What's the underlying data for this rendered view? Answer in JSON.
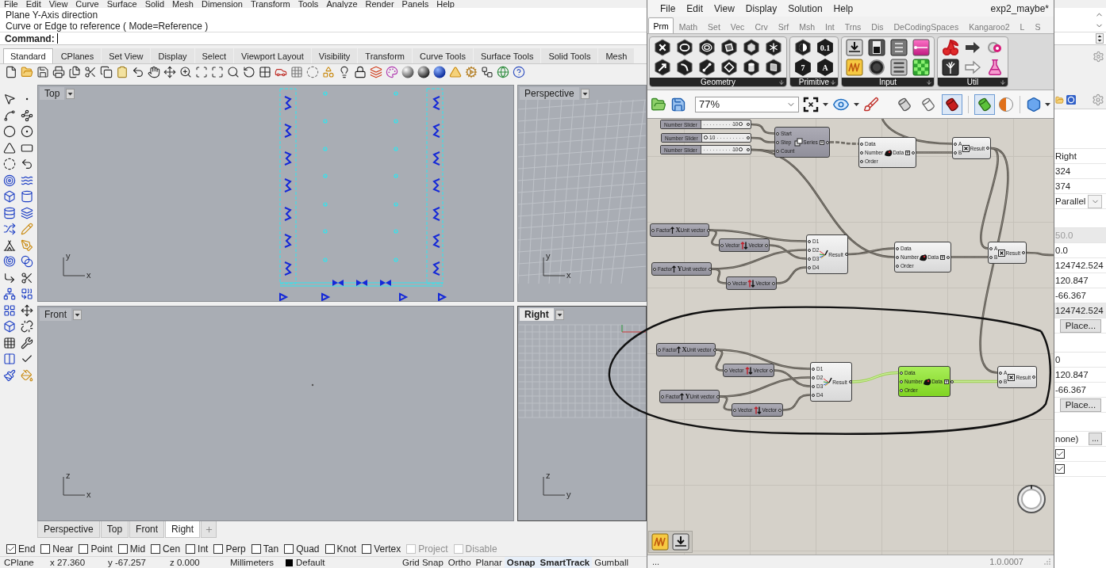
{
  "rhino": {
    "menu": [
      "File",
      "Edit",
      "View",
      "Curve",
      "Surface",
      "Solid",
      "Mesh",
      "Dimension",
      "Transform",
      "Tools",
      "Analyze",
      "Render",
      "Panels",
      "Help"
    ],
    "command_history": [
      "Plane Y-Axis direction",
      "Curve or Edge to reference ( Mode=Reference )"
    ],
    "command_prompt": "Command:",
    "toolbar_tabs": [
      {
        "label": "Standard",
        "selected": true
      },
      {
        "label": "CPlanes",
        "selected": false
      },
      {
        "label": "Set View",
        "selected": false
      },
      {
        "label": "Display",
        "selected": false
      },
      {
        "label": "Select",
        "selected": false
      },
      {
        "label": "Viewport Layout",
        "selected": false
      },
      {
        "label": "Visibility",
        "selected": false
      },
      {
        "label": "Transform",
        "selected": false
      },
      {
        "label": "Curve Tools",
        "selected": false
      },
      {
        "label": "Surface Tools",
        "selected": false
      },
      {
        "label": "Solid Tools",
        "selected": false
      },
      {
        "label": "Mesh",
        "selected": false
      }
    ],
    "viewports": [
      {
        "kind": "top",
        "title": "Top",
        "active": false,
        "axes": [
          "y",
          "x"
        ]
      },
      {
        "kind": "perspective",
        "title": "Perspective",
        "active": false,
        "axes": [
          "y",
          "x"
        ]
      },
      {
        "kind": "front",
        "title": "Front",
        "active": false,
        "axes": [
          "z",
          "x"
        ]
      },
      {
        "kind": "right",
        "title": "Right",
        "active": true,
        "axes": [
          "z",
          "y"
        ]
      }
    ],
    "viewport_tabs": [
      {
        "label": "Perspective",
        "selected": false
      },
      {
        "label": "Top",
        "selected": false
      },
      {
        "label": "Front",
        "selected": false
      },
      {
        "label": "Right",
        "selected": true
      }
    ],
    "osnaps": [
      {
        "label": "End",
        "checked": true,
        "disabled": false
      },
      {
        "label": "Near",
        "checked": false,
        "disabled": false
      },
      {
        "label": "Point",
        "checked": false,
        "disabled": false
      },
      {
        "label": "Mid",
        "checked": false,
        "disabled": false
      },
      {
        "label": "Cen",
        "checked": false,
        "disabled": false
      },
      {
        "label": "Int",
        "checked": false,
        "disabled": false
      },
      {
        "label": "Perp",
        "checked": false,
        "disabled": false
      },
      {
        "label": "Tan",
        "checked": false,
        "disabled": false
      },
      {
        "label": "Quad",
        "checked": false,
        "disabled": false
      },
      {
        "label": "Knot",
        "checked": false,
        "disabled": false
      },
      {
        "label": "Vertex",
        "checked": false,
        "disabled": false
      },
      {
        "label": "Project",
        "checked": false,
        "disabled": true
      },
      {
        "label": "Disable",
        "checked": false,
        "disabled": true
      }
    ],
    "status_bar": {
      "cplane": "CPlane",
      "x": "x 27.360",
      "y": "y -67.257",
      "z": "z 0.000",
      "units": "Millimeters",
      "layer": "Default",
      "toggles": [
        {
          "label": "Grid Snap",
          "on": false
        },
        {
          "label": "Ortho",
          "on": false
        },
        {
          "label": "Planar",
          "on": false
        },
        {
          "label": "Osnap",
          "on": true
        },
        {
          "label": "SmartTrack",
          "on": true
        },
        {
          "label": "Gumball",
          "on": false
        }
      ]
    },
    "properties": [
      [
        {
          "kind": "text",
          "value": "Right"
        },
        {
          "kind": "text",
          "value": "324"
        },
        {
          "kind": "text",
          "value": "374"
        },
        {
          "kind": "select",
          "value": "Parallel"
        }
      ],
      [
        {
          "kind": "disabled",
          "value": "50.0"
        },
        {
          "kind": "text",
          "value": "0.0"
        },
        {
          "kind": "text",
          "value": "124742.524"
        },
        {
          "kind": "text",
          "value": "120.847"
        },
        {
          "kind": "text",
          "value": "-66.367"
        },
        {
          "kind": "readonly",
          "value": "124742.524"
        },
        {
          "kind": "button",
          "value": "Place..."
        }
      ],
      [
        {
          "kind": "text",
          "value": "0"
        },
        {
          "kind": "text",
          "value": "120.847"
        },
        {
          "kind": "text",
          "value": "-66.367"
        },
        {
          "kind": "button",
          "value": "Place..."
        }
      ],
      [
        {
          "kind": "browse",
          "value": "none)",
          "button": "..."
        },
        {
          "kind": "checkbox",
          "checked": true
        },
        {
          "kind": "checkbox",
          "checked": true
        }
      ]
    ]
  },
  "grasshopper": {
    "menu": [
      "File",
      "Edit",
      "View",
      "Display",
      "Solution",
      "Help"
    ],
    "document": "exp2_maybe*",
    "tabs": [
      {
        "label": "Prm",
        "selected": true
      },
      {
        "label": "Math",
        "selected": false
      },
      {
        "label": "Set",
        "selected": false
      },
      {
        "label": "Vec",
        "selected": false
      },
      {
        "label": "Crv",
        "selected": false
      },
      {
        "label": "Srf",
        "selected": false
      },
      {
        "label": "Msh",
        "selected": false
      },
      {
        "label": "Int",
        "selected": false
      },
      {
        "label": "Trns",
        "selected": false
      },
      {
        "label": "Dis",
        "selected": false
      },
      {
        "label": "DeCodingSpaces",
        "selected": false
      },
      {
        "label": "Kangaroo2",
        "selected": false
      },
      {
        "label": "L",
        "selected": false
      },
      {
        "label": "S",
        "selected": false
      }
    ],
    "panels": [
      {
        "kind": "geometry",
        "title": "Geometry"
      },
      {
        "kind": "primitive",
        "title": "Primitive",
        "glyphs": [
          "0.1",
          "7",
          "A"
        ]
      },
      {
        "kind": "input",
        "title": "Input"
      },
      {
        "kind": "util",
        "title": "Util"
      }
    ],
    "zoom": "77%",
    "preview_modes": [
      {
        "selected": false
      },
      {
        "selected": false
      },
      {
        "selected": true
      }
    ],
    "selected_only_preview": true,
    "nodes": [
      {
        "kind": "slider",
        "label": "Number Slider",
        "value": "10",
        "level": 0.95
      },
      {
        "kind": "slider",
        "label": "Number Slider",
        "value": "10",
        "level": 0.05
      },
      {
        "kind": "slider",
        "label": "Number Slider",
        "value": "10",
        "level": 0.95
      },
      {
        "kind": "series",
        "inputs": [
          "Start",
          "Step",
          "Count"
        ],
        "outputs": [
          "Series"
        ],
        "dimmed": true,
        "selected": false
      },
      {
        "kind": "sort",
        "inputs": [
          "Data",
          "Number",
          "Order"
        ],
        "outputs": [
          "Data"
        ],
        "dimmed": false,
        "selected": false
      },
      {
        "kind": "multiply",
        "inputs": [
          "A",
          "B"
        ],
        "outputs": [
          "Result"
        ],
        "dimmed": false,
        "selected": false
      },
      {
        "kind": "unit-vector",
        "inputs": [
          "Factor"
        ],
        "outputs": [
          "Unit vector"
        ],
        "glyph": "X",
        "dimmed": true,
        "selected": false
      },
      {
        "kind": "reverse",
        "inputs": [
          "Vector"
        ],
        "outputs": [
          "Vector"
        ],
        "dimmed": true,
        "selected": false
      },
      {
        "kind": "unit-vector",
        "inputs": [
          "Factor"
        ],
        "outputs": [
          "Unit vector"
        ],
        "glyph": "Y",
        "dimmed": true,
        "selected": false
      },
      {
        "kind": "reverse",
        "inputs": [
          "Vector"
        ],
        "outputs": [
          "Vector"
        ],
        "dimmed": true,
        "selected": false
      },
      {
        "kind": "merge",
        "inputs": [
          "D1",
          "D2",
          "D3",
          "D4"
        ],
        "outputs": [
          "Result"
        ],
        "dimmed": false,
        "selected": false
      },
      {
        "kind": "sort",
        "inputs": [
          "Data",
          "Number",
          "Order"
        ],
        "outputs": [
          "Data"
        ],
        "dimmed": false,
        "selected": false
      },
      {
        "kind": "multiply",
        "inputs": [
          "A",
          "B"
        ],
        "outputs": [
          "Result"
        ],
        "dimmed": false,
        "selected": false
      },
      {
        "kind": "unit-vector",
        "inputs": [
          "Factor"
        ],
        "outputs": [
          "Unit vector"
        ],
        "glyph": "X",
        "dimmed": true,
        "selected": false
      },
      {
        "kind": "reverse",
        "inputs": [
          "Vector"
        ],
        "outputs": [
          "Vector"
        ],
        "dimmed": true,
        "selected": false
      },
      {
        "kind": "unit-vector",
        "inputs": [
          "Factor"
        ],
        "outputs": [
          "Unit vector"
        ],
        "glyph": "Y",
        "dimmed": true,
        "selected": false
      },
      {
        "kind": "reverse",
        "inputs": [
          "Vector"
        ],
        "outputs": [
          "Vector"
        ],
        "dimmed": true,
        "selected": false
      },
      {
        "kind": "merge",
        "inputs": [
          "D1",
          "D2",
          "D3",
          "D4"
        ],
        "outputs": [
          "Result"
        ],
        "dimmed": false,
        "selected": false
      },
      {
        "kind": "sort",
        "inputs": [
          "Data",
          "Number",
          "Order"
        ],
        "outputs": [
          "Data"
        ],
        "dimmed": false,
        "selected": true
      },
      {
        "kind": "multiply",
        "inputs": [
          "A",
          "B"
        ],
        "outputs": [
          "Result"
        ],
        "dimmed": false,
        "selected": false
      }
    ],
    "status": "...",
    "version": "1.0.0007"
  }
}
